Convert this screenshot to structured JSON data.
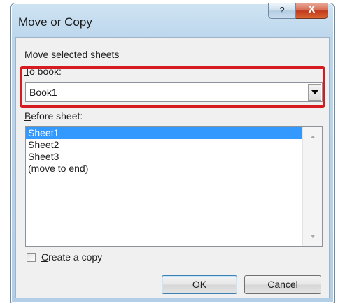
{
  "dialog": {
    "title": "Move or Copy",
    "help_glyph": "?",
    "close_glyph": "X"
  },
  "move_label": "Move selected sheets",
  "to_book": {
    "label_accel": "T",
    "label_rest": "o book:",
    "selected_value": "Book1"
  },
  "before_sheet": {
    "label_accel": "B",
    "label_rest": "efore sheet:",
    "items": [
      "Sheet1",
      "Sheet2",
      "Sheet3",
      "(move to end)"
    ],
    "selected_index": 0
  },
  "create_copy": {
    "label_accel": "C",
    "label_rest": "reate a copy",
    "checked": false
  },
  "buttons": {
    "ok": "OK",
    "cancel": "Cancel"
  },
  "colors": {
    "highlight_border": "#d71920",
    "selection": "#3399ff"
  }
}
